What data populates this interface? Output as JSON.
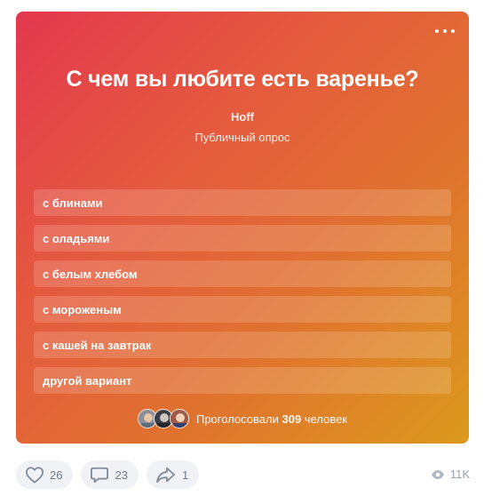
{
  "poll": {
    "question": "С чем вы любите есть варенье?",
    "author": "Hoff",
    "type": "Публичный опрос",
    "options": [
      {
        "label": "с блинами"
      },
      {
        "label": "с оладьями"
      },
      {
        "label": "с белым хлебом"
      },
      {
        "label": "с мороженым"
      },
      {
        "label": "с кашей на завтрак"
      },
      {
        "label": "другой вариант"
      }
    ],
    "voters": {
      "prefix": "Проголосовали ",
      "count": "309",
      "suffix": " человек"
    },
    "gradient_colors": [
      "#e3384f",
      "#e0722f",
      "#dc9a1d"
    ]
  },
  "footer": {
    "likes": "26",
    "comments": "23",
    "shares": "1",
    "views": "11K"
  },
  "icons": [
    "more-icon",
    "heart-icon",
    "comment-icon",
    "share-icon",
    "eye-icon"
  ]
}
